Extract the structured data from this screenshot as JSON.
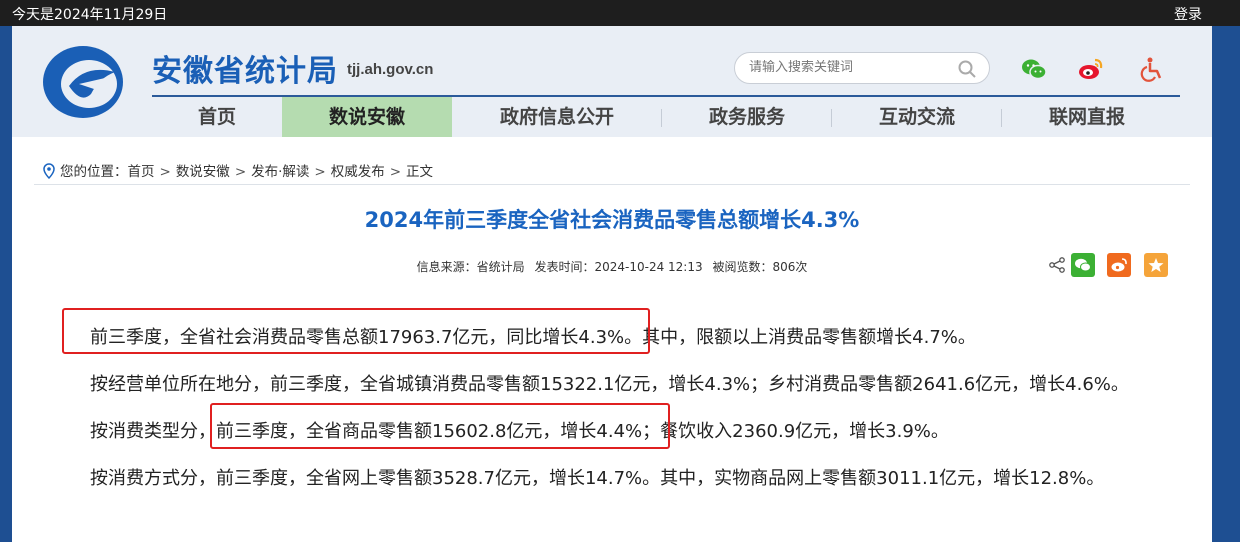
{
  "topbar": {
    "date": "今天是2024年11月29日",
    "login": "登录"
  },
  "site": {
    "name": "安徽省统计局",
    "domain": "tjj.ah.gov.cn"
  },
  "search": {
    "placeholder": "请输入搜索关键词"
  },
  "header_icons": [
    "wechat-icon",
    "weibo-icon",
    "accessibility-icon"
  ],
  "nav": {
    "items": [
      "首页",
      "数说安徽",
      "政府信息公开",
      "政务服务",
      "互动交流",
      "联网直报"
    ],
    "active_index": 1
  },
  "breadcrumb": {
    "label": "您的位置：",
    "items": [
      "首页",
      "数说安徽",
      "发布·解读",
      "权威发布",
      "正文"
    ]
  },
  "article": {
    "title": "2024年前三季度全省社会消费品零售总额增长4.3%",
    "meta": {
      "source": "信息来源：省统计局",
      "published": "发表时间：2024-10-24 12:13",
      "views": "被阅览数：806次"
    },
    "paragraphs": [
      "前三季度，全省社会消费品零售总额17963.7亿元，同比增长4.3%。其中，限额以上消费品零售额增长4.7%。",
      "按经营单位所在地分，前三季度，全省城镇消费品零售额15322.1亿元，增长4.3%；乡村消费品零售额2641.6亿元，增长4.6%。",
      "按消费类型分，前三季度，全省商品零售额15602.8亿元，增长4.4%；餐饮收入2360.9亿元，增长3.9%。",
      "按消费方式分，前三季度，全省网上零售额3528.7亿元，增长14.7%。其中，实物商品网上零售额3011.1亿元，增长12.8%。"
    ]
  },
  "share_icons": [
    "share-icon",
    "wechat-share-icon",
    "weibo-share-icon",
    "favorite-icon"
  ],
  "colors": {
    "brand": "#1a5fb6",
    "title": "#1a64c0",
    "nav_active": "#b5dcb0",
    "highlight": "#e02020",
    "wechat": "#3cb034",
    "weibo": "#f06a1e",
    "favorite": "#f5a43a"
  }
}
